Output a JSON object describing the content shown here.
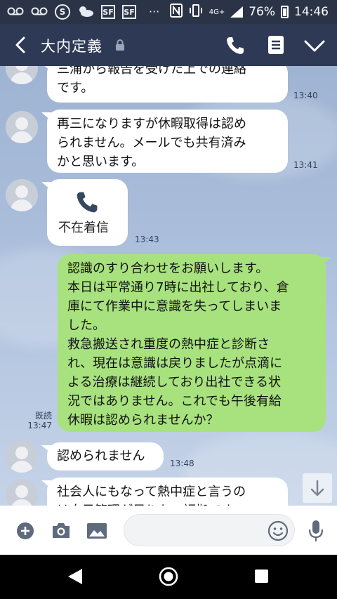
{
  "status_bar": {
    "icons": [
      "voicemail-icon",
      "voicemail-icon",
      "skype-icon",
      "weather-icon",
      "sf-icon",
      "sf-icon",
      "more-notifications-icon",
      "nfc-icon",
      "vibrate-icon",
      "signal-icon"
    ],
    "more": "···",
    "network": "4G+",
    "battery": "76%",
    "time": "14:46"
  },
  "header": {
    "title": "大内定義"
  },
  "messages": [
    {
      "side": "left",
      "text": "三浦から報告を受けた上での連絡\nです。",
      "time": "13:40"
    },
    {
      "side": "left",
      "text": "再三になりますが休暇取得は認め\nられません。メールでも共有済み\nかと思います。",
      "time": "13:41"
    },
    {
      "side": "left",
      "type": "missed-call",
      "text": "不在着信",
      "time": "13:43"
    },
    {
      "side": "right",
      "text": "認識のすり合わせをお願いします。\n本日は平常通り7時に出社しており、倉\n庫にて作業中に意識を失ってしまいま\nした。\n救急搬送され重度の熱中症と診断さ\nれ、現在は意識は戻りましたが点滴に\nよる治療は継続しており出社できる状\n況ではありません。これでも午後有給\n休暇は認められませんか？",
      "read": "既読",
      "time": "13:47"
    },
    {
      "side": "left",
      "text": "認められません",
      "time": "13:48"
    },
    {
      "side": "left",
      "text": "社会人にもなって熱中症と言うの\nは自己管理が足りない証拠です。",
      "time": ""
    }
  ],
  "colors": {
    "header": "#2e3a55",
    "status_bar": "#2b3447",
    "own_bubble": "#a8e27e",
    "other_bubble": "#ffffff"
  }
}
